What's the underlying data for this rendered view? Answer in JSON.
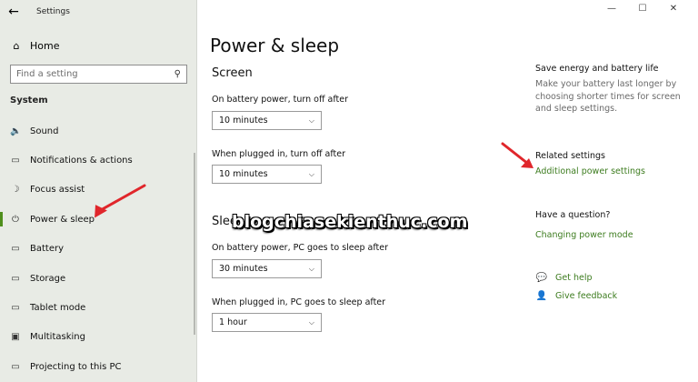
{
  "window": {
    "title": "Settings",
    "controls": {
      "minimize": "—",
      "maximize": "☐",
      "close": "✕"
    }
  },
  "sidebar": {
    "back_icon": "←",
    "home": {
      "label": "Home",
      "icon": "⌂"
    },
    "search": {
      "placeholder": "Find a setting",
      "icon": "⚲"
    },
    "section": "System",
    "items": [
      {
        "label": "Sound",
        "icon": "🔈"
      },
      {
        "label": "Notifications & actions",
        "icon": "▭"
      },
      {
        "label": "Focus assist",
        "icon": "☽"
      },
      {
        "label": "Power & sleep",
        "icon": "⏻",
        "selected": true
      },
      {
        "label": "Battery",
        "icon": "▭"
      },
      {
        "label": "Storage",
        "icon": "▭"
      },
      {
        "label": "Tablet mode",
        "icon": "▭"
      },
      {
        "label": "Multitasking",
        "icon": "▣"
      },
      {
        "label": "Projecting to this PC",
        "icon": "▭"
      }
    ]
  },
  "main": {
    "title": "Power & sleep",
    "screen": {
      "heading": "Screen",
      "battery_label": "On battery power, turn off after",
      "battery_value": "10 minutes",
      "plugged_label": "When plugged in, turn off after",
      "plugged_value": "10 minutes"
    },
    "sleep": {
      "heading": "Slee",
      "battery_label": "On battery power, PC goes to sleep after",
      "battery_value": "30 minutes",
      "plugged_label": "When plugged in, PC goes to sleep after",
      "plugged_value": "1 hour"
    },
    "chevron": "⌵"
  },
  "right": {
    "energy_heading": "Save energy and battery life",
    "energy_text": "Make your battery last longer by choosing shorter times for screen and sleep settings.",
    "related_heading": "Related settings",
    "related_link": "Additional power settings",
    "question_heading": "Have a question?",
    "question_link": "Changing power mode",
    "help": {
      "label": "Get help",
      "icon": "💬"
    },
    "feedback": {
      "label": "Give feedback",
      "icon": "👤"
    }
  },
  "watermark": "blogchiasekienthuc.com",
  "colors": {
    "accent": "#3d7c1f",
    "sidebar_bg": "#e8ebe5",
    "arrow": "#e0262b"
  }
}
